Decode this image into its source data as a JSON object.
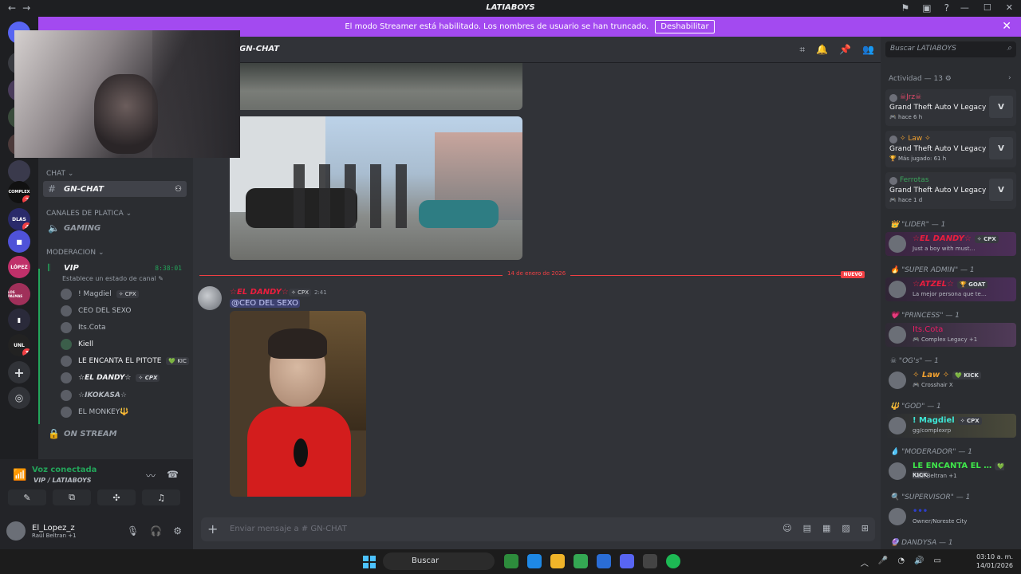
{
  "window": {
    "title": "LATIABOYS",
    "nav_back": "←",
    "nav_fwd": "→",
    "min": "—",
    "max": "☐",
    "close": "✕"
  },
  "streamer_banner": {
    "text": "El modo Streamer está habilitado. Los nombres de usuario se han truncado.",
    "button": "Deshabilitar",
    "close": "✕"
  },
  "servers": [
    {
      "label": "COMPLEX",
      "badge": "2"
    },
    {
      "label": "DLAS",
      "badge": "4"
    },
    {
      "label": "LÓPEZ",
      "badge": ""
    },
    {
      "label": "LOS PALMAS",
      "badge": ""
    },
    {
      "label": "UNL",
      "badge": "3"
    }
  ],
  "sidebar": {
    "cat_chat": "CHAT ⌄",
    "gn_chat": "GN-CHAT",
    "cat_platica": "CANALES DE PLATICA ⌄",
    "gaming": "GAMING",
    "cat_moderacion": "MODERACION ⌄",
    "vip": "VIP",
    "vip_timer": "8:38:01",
    "vip_status": "Establece un estado de canal ✎",
    "voice_users": [
      {
        "name": "! Magdiel",
        "tag": "✧ CPX"
      },
      {
        "name": "CEO DEL SEXO",
        "tag": ""
      },
      {
        "name": "Its.Cota",
        "tag": ""
      },
      {
        "name": "Kiell",
        "tag": ""
      },
      {
        "name": "LE ENCANTA EL PITOTE",
        "tag": "💚 KIC"
      },
      {
        "name": "☆EL DANDY☆",
        "tag": "✧ CPX"
      },
      {
        "name": "☆IKOKASA☆",
        "tag": ""
      },
      {
        "name": "EL MONKEY🔱",
        "tag": ""
      }
    ],
    "on_stream": "ON STREAM"
  },
  "voice_panel": {
    "status": "Voz conectada",
    "channel": "VIP / LATIABOYS",
    "user_name": "El_Lopez_z",
    "user_status": "Raúl Beltran +1"
  },
  "chat": {
    "channel_name": "GN-CHAT",
    "date_divider": "14 de enero de 2026",
    "new_badge": "NUEVO",
    "author": "☆EL DANDY☆",
    "author_tag": "✧ CPX",
    "time": "2:41",
    "mention": "@CEO DEL SEXO",
    "composer_placeholder": "Enviar mensaje a # GN-CHAT"
  },
  "members": {
    "search_placeholder": "Buscar LATIABOYS",
    "activity_header": "Actividad — 13 ⚙",
    "activities": [
      {
        "name": "☠Jrz☠",
        "game": "Grand Theft Auto V Legacy",
        "time": "🎮 hace 6 h",
        "color": "#e04a6a"
      },
      {
        "name": "✧ Law ✧",
        "game": "Grand Theft Auto V Legacy",
        "time": "🏆 Más jugado: 61 h",
        "color": "#f0a030"
      },
      {
        "name": "Ferrotas",
        "game": "Grand Theft Auto V Legacy",
        "time": "🎮 hace 1 d",
        "color": "#3ba55c"
      }
    ],
    "groups": [
      {
        "role": "👑 \"LIDER\" — 1",
        "name": "☆EL DANDY☆",
        "tag": "✧ CPX",
        "sub": "Just a boy with must…",
        "color": "#e91e3e"
      },
      {
        "role": "🔥 \"SUPER ADMIN\" — 1",
        "name": "☆ATZEL☆",
        "tag": "🏆 GOAT",
        "sub": "La mejor persona que te…",
        "color": "#e91e3e"
      },
      {
        "role": "💗 \"PRINCESS\" — 1",
        "name": "Its.Cota",
        "tag": "",
        "sub": "🎮 Complex Legacy +1",
        "color": "#e91e63"
      },
      {
        "role": "☠ \"OG's\" — 1",
        "name": "✧ Law ✧",
        "tag": "💚 KICK",
        "sub": "🎮 Crosshair X",
        "color": "#f0a030"
      },
      {
        "role": "🔱 \"GOD\" — 1",
        "name": "! Magdiel",
        "tag": "✧ CPX",
        "sub": "gg/complexrp",
        "color": "#3ee6d6"
      },
      {
        "role": "💧 \"MODERADOR\" — 1",
        "name": "LE ENCANTA EL …",
        "tag": "💚 KICK",
        "sub": "Raúl Beltran +1",
        "color": "#3ee64a"
      },
      {
        "role": "🔍 \"SUPERVISOR\" — 1",
        "name": "•••",
        "tag": "",
        "sub": "Owner/Noreste City",
        "color": "#2c3ec9"
      },
      {
        "role": "🔮 DANDYSA — 1",
        "name": "",
        "tag": "",
        "sub": "",
        "color": "#9b59b6"
      }
    ]
  },
  "taskbar": {
    "search": "Buscar",
    "time": "03:10 a. m.",
    "date": "14/01/2026"
  }
}
